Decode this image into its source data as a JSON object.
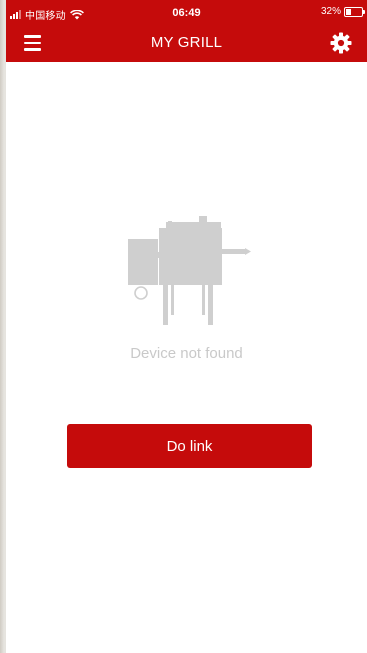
{
  "status_bar": {
    "carrier": "中国移动",
    "time": "06:49",
    "battery_percent_text": "32%",
    "battery_level": 0.32
  },
  "header": {
    "title": "MY GRILL",
    "menu_icon": "hamburger-menu-icon",
    "settings_icon": "gear-icon"
  },
  "empty_state": {
    "icon": "grill-icon",
    "message": "Device not found"
  },
  "actions": {
    "link_label": "Do link"
  },
  "colors": {
    "brand_red": "#c50b0b",
    "muted_text": "#c9c9c9",
    "icon_gray": "#cfcfcf"
  }
}
